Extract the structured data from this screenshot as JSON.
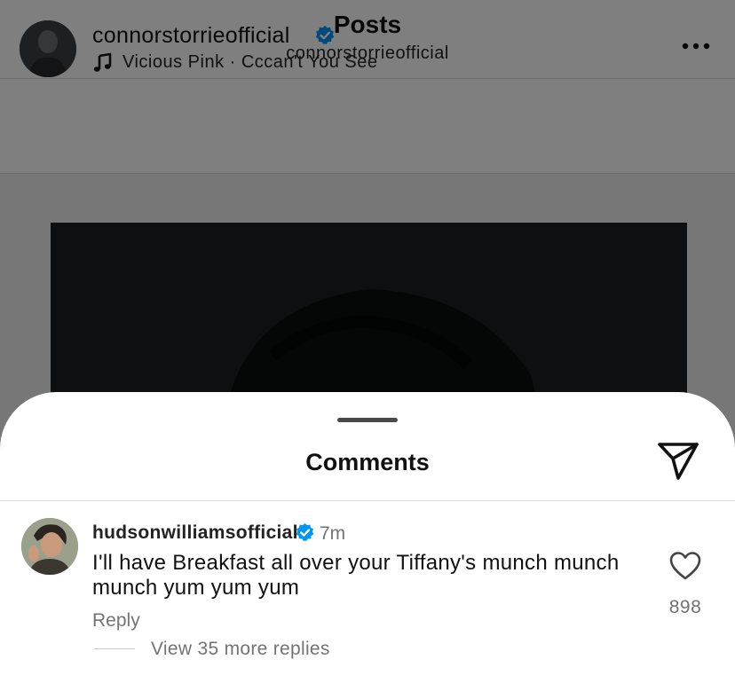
{
  "header": {
    "title": "Posts",
    "subtitle": "connorstorrieofficial"
  },
  "post": {
    "username": "connorstorrieofficial",
    "music": "Vicious Pink · Cccan't You See"
  },
  "comments_sheet": {
    "title": "Comments",
    "comments": [
      {
        "username": "hudsonwilliamsofficial",
        "time": "7m",
        "text": "I'll have Breakfast all over your Tiffany's munch munch munch yum yum yum",
        "reply_label": "Reply",
        "like_count": "898",
        "view_replies_label": "View 35 more replies"
      }
    ]
  },
  "colors": {
    "verified_blue": "#0095f6",
    "overlay": "rgba(0,0,0,0.5)",
    "secondary_text": "#737373"
  },
  "icons": [
    "back-arrow-icon",
    "verified-badge-icon",
    "music-note-icon",
    "more-options-icon",
    "share-paper-plane-icon",
    "heart-icon"
  ]
}
